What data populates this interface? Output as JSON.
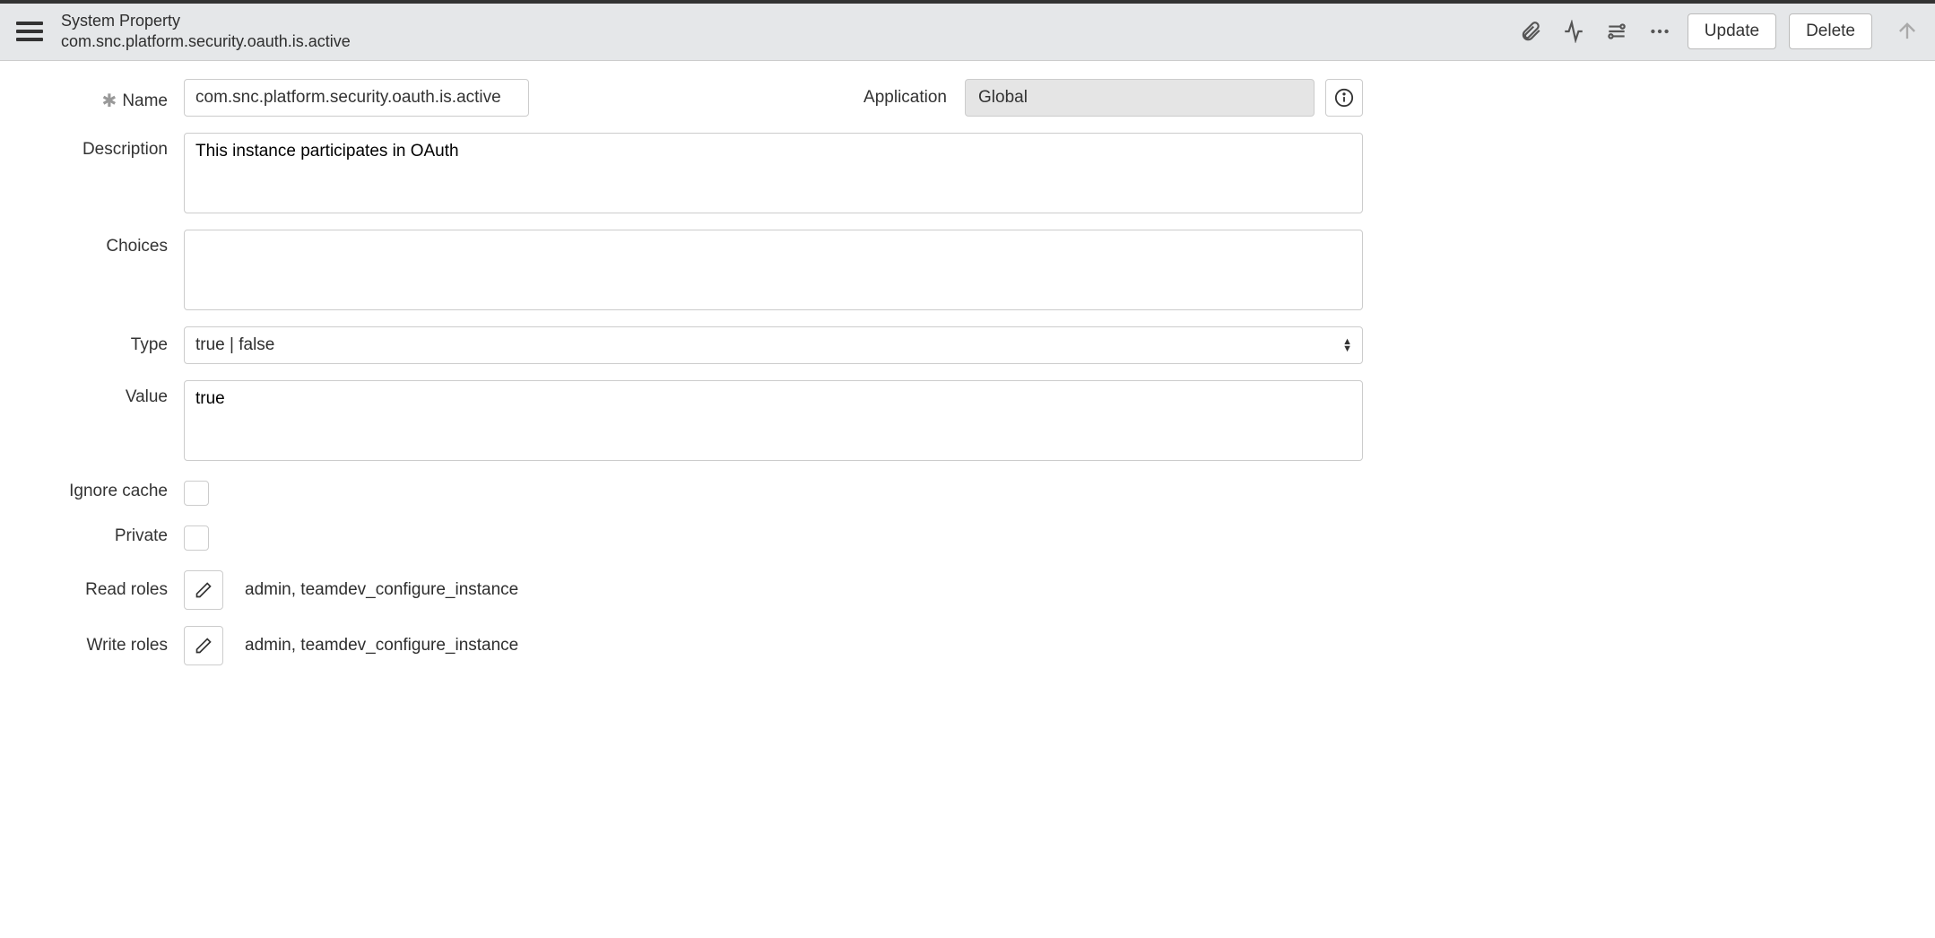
{
  "header": {
    "record_type": "System Property",
    "record_name": "com.snc.platform.security.oauth.is.active",
    "update_label": "Update",
    "delete_label": "Delete"
  },
  "form": {
    "name_label": "Name",
    "name_value": "com.snc.platform.security.oauth.is.active",
    "application_label": "Application",
    "application_value": "Global",
    "description_label": "Description",
    "description_value": "This instance participates in OAuth",
    "choices_label": "Choices",
    "choices_value": "",
    "type_label": "Type",
    "type_value": "true | false",
    "value_label": "Value",
    "value_value": "true",
    "ignore_cache_label": "Ignore cache",
    "ignore_cache_checked": false,
    "private_label": "Private",
    "private_checked": false,
    "read_roles_label": "Read roles",
    "read_roles_value": "admin, teamdev_configure_instance",
    "write_roles_label": "Write roles",
    "write_roles_value": "admin, teamdev_configure_instance"
  }
}
